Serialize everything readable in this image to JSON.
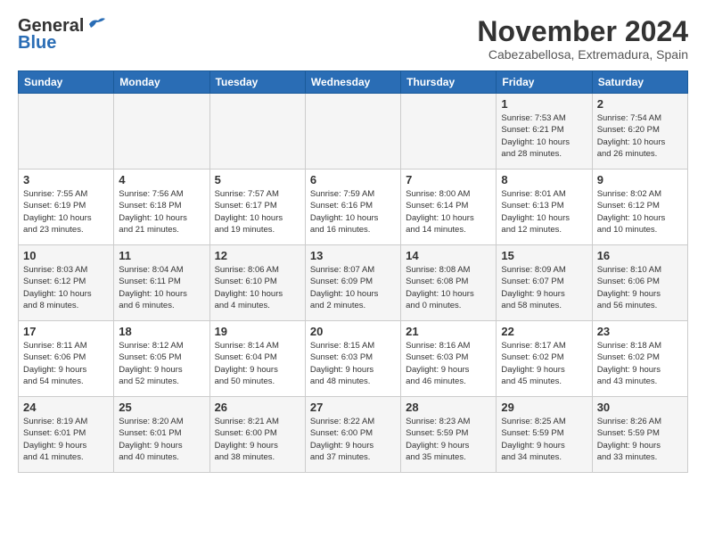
{
  "logo": {
    "line1": "General",
    "line2": "Blue"
  },
  "title": "November 2024",
  "location": "Cabezabellosa, Extremadura, Spain",
  "weekdays": [
    "Sunday",
    "Monday",
    "Tuesday",
    "Wednesday",
    "Thursday",
    "Friday",
    "Saturday"
  ],
  "weeks": [
    [
      {
        "day": "",
        "detail": ""
      },
      {
        "day": "",
        "detail": ""
      },
      {
        "day": "",
        "detail": ""
      },
      {
        "day": "",
        "detail": ""
      },
      {
        "day": "",
        "detail": ""
      },
      {
        "day": "1",
        "detail": "Sunrise: 7:53 AM\nSunset: 6:21 PM\nDaylight: 10 hours\nand 28 minutes."
      },
      {
        "day": "2",
        "detail": "Sunrise: 7:54 AM\nSunset: 6:20 PM\nDaylight: 10 hours\nand 26 minutes."
      }
    ],
    [
      {
        "day": "3",
        "detail": "Sunrise: 7:55 AM\nSunset: 6:19 PM\nDaylight: 10 hours\nand 23 minutes."
      },
      {
        "day": "4",
        "detail": "Sunrise: 7:56 AM\nSunset: 6:18 PM\nDaylight: 10 hours\nand 21 minutes."
      },
      {
        "day": "5",
        "detail": "Sunrise: 7:57 AM\nSunset: 6:17 PM\nDaylight: 10 hours\nand 19 minutes."
      },
      {
        "day": "6",
        "detail": "Sunrise: 7:59 AM\nSunset: 6:16 PM\nDaylight: 10 hours\nand 16 minutes."
      },
      {
        "day": "7",
        "detail": "Sunrise: 8:00 AM\nSunset: 6:14 PM\nDaylight: 10 hours\nand 14 minutes."
      },
      {
        "day": "8",
        "detail": "Sunrise: 8:01 AM\nSunset: 6:13 PM\nDaylight: 10 hours\nand 12 minutes."
      },
      {
        "day": "9",
        "detail": "Sunrise: 8:02 AM\nSunset: 6:12 PM\nDaylight: 10 hours\nand 10 minutes."
      }
    ],
    [
      {
        "day": "10",
        "detail": "Sunrise: 8:03 AM\nSunset: 6:12 PM\nDaylight: 10 hours\nand 8 minutes."
      },
      {
        "day": "11",
        "detail": "Sunrise: 8:04 AM\nSunset: 6:11 PM\nDaylight: 10 hours\nand 6 minutes."
      },
      {
        "day": "12",
        "detail": "Sunrise: 8:06 AM\nSunset: 6:10 PM\nDaylight: 10 hours\nand 4 minutes."
      },
      {
        "day": "13",
        "detail": "Sunrise: 8:07 AM\nSunset: 6:09 PM\nDaylight: 10 hours\nand 2 minutes."
      },
      {
        "day": "14",
        "detail": "Sunrise: 8:08 AM\nSunset: 6:08 PM\nDaylight: 10 hours\nand 0 minutes."
      },
      {
        "day": "15",
        "detail": "Sunrise: 8:09 AM\nSunset: 6:07 PM\nDaylight: 9 hours\nand 58 minutes."
      },
      {
        "day": "16",
        "detail": "Sunrise: 8:10 AM\nSunset: 6:06 PM\nDaylight: 9 hours\nand 56 minutes."
      }
    ],
    [
      {
        "day": "17",
        "detail": "Sunrise: 8:11 AM\nSunset: 6:06 PM\nDaylight: 9 hours\nand 54 minutes."
      },
      {
        "day": "18",
        "detail": "Sunrise: 8:12 AM\nSunset: 6:05 PM\nDaylight: 9 hours\nand 52 minutes."
      },
      {
        "day": "19",
        "detail": "Sunrise: 8:14 AM\nSunset: 6:04 PM\nDaylight: 9 hours\nand 50 minutes."
      },
      {
        "day": "20",
        "detail": "Sunrise: 8:15 AM\nSunset: 6:03 PM\nDaylight: 9 hours\nand 48 minutes."
      },
      {
        "day": "21",
        "detail": "Sunrise: 8:16 AM\nSunset: 6:03 PM\nDaylight: 9 hours\nand 46 minutes."
      },
      {
        "day": "22",
        "detail": "Sunrise: 8:17 AM\nSunset: 6:02 PM\nDaylight: 9 hours\nand 45 minutes."
      },
      {
        "day": "23",
        "detail": "Sunrise: 8:18 AM\nSunset: 6:02 PM\nDaylight: 9 hours\nand 43 minutes."
      }
    ],
    [
      {
        "day": "24",
        "detail": "Sunrise: 8:19 AM\nSunset: 6:01 PM\nDaylight: 9 hours\nand 41 minutes."
      },
      {
        "day": "25",
        "detail": "Sunrise: 8:20 AM\nSunset: 6:01 PM\nDaylight: 9 hours\nand 40 minutes."
      },
      {
        "day": "26",
        "detail": "Sunrise: 8:21 AM\nSunset: 6:00 PM\nDaylight: 9 hours\nand 38 minutes."
      },
      {
        "day": "27",
        "detail": "Sunrise: 8:22 AM\nSunset: 6:00 PM\nDaylight: 9 hours\nand 37 minutes."
      },
      {
        "day": "28",
        "detail": "Sunrise: 8:23 AM\nSunset: 5:59 PM\nDaylight: 9 hours\nand 35 minutes."
      },
      {
        "day": "29",
        "detail": "Sunrise: 8:25 AM\nSunset: 5:59 PM\nDaylight: 9 hours\nand 34 minutes."
      },
      {
        "day": "30",
        "detail": "Sunrise: 8:26 AM\nSunset: 5:59 PM\nDaylight: 9 hours\nand 33 minutes."
      }
    ]
  ]
}
